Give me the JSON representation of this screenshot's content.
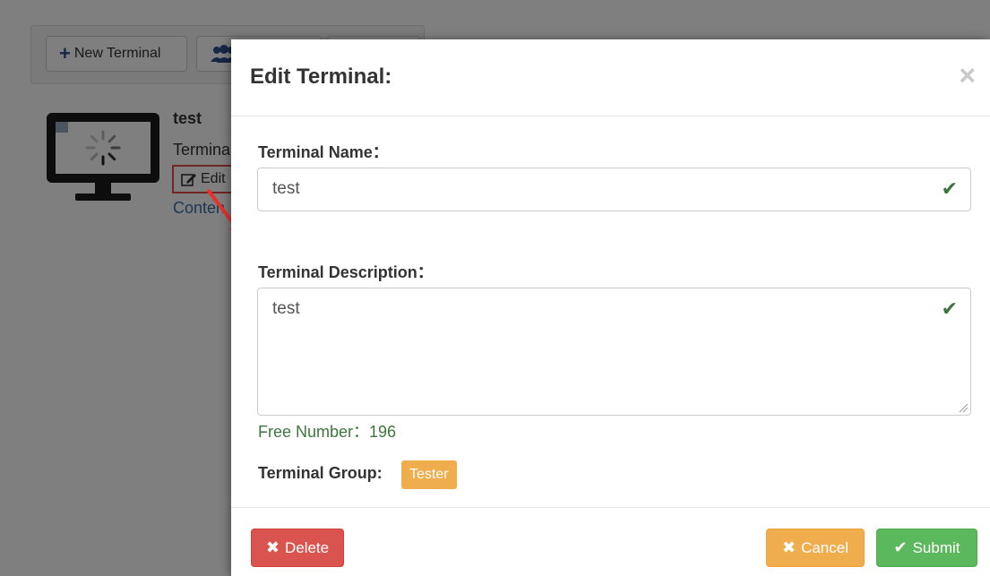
{
  "toolbar": {
    "new_terminal_label": "New Terminal",
    "group_button_label": "",
    "third_button_label": ""
  },
  "terminal_card": {
    "name": "test",
    "label_partial": "Termina",
    "edit_label": "Edit",
    "content_label": "Conten"
  },
  "modal": {
    "title": "Edit Terminal:",
    "close_glyph": "×",
    "name_label": "Terminal Name：",
    "name_value": "test",
    "description_label": "Terminal Description：",
    "description_value": "test",
    "free_number_text": "Free Number：196",
    "group_label": "Terminal Group:",
    "group_badge": "Tester",
    "check_glyph": "✔",
    "delete_label": "Delete",
    "cancel_label": "Cancel",
    "submit_label": "Submit",
    "delete_icon": "✖",
    "cancel_icon": "✖",
    "submit_icon": "✔"
  },
  "colors": {
    "delete": "#d9534f",
    "cancel": "#f0ad4e",
    "submit": "#5cb85c",
    "badge": "#f0ad4e",
    "success_text": "#3c763d",
    "highlight": "#e24a4a"
  }
}
